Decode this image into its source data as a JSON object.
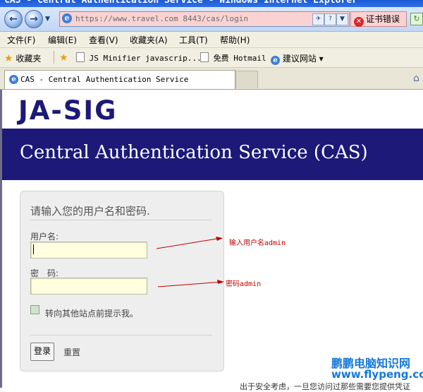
{
  "window": {
    "title": "CAS  -  Central Authentication Service  -  Windows Internet Explorer"
  },
  "address_bar": {
    "url": "https://www.travel.com 8443/cas/login",
    "cert_error": "证书错误"
  },
  "menu": {
    "items": [
      "文件(F)",
      "编辑(E)",
      "查看(V)",
      "收藏夹(A)",
      "工具(T)",
      "帮助(H)"
    ]
  },
  "favorites_bar": {
    "favorites_label": "收藏夹",
    "items": [
      "JS Minifier javascrip...",
      "免费 Hotmail",
      "建议网站"
    ]
  },
  "tab": {
    "label": "CAS  -  Central Authentication Service"
  },
  "page": {
    "logo_text": "JA-SIG",
    "banner_title": "Central Authentication Service (CAS)",
    "form": {
      "heading": "请输入您的用户名和密码.",
      "username_label": "用户名:",
      "username_value": "",
      "password_label": "密　码:",
      "password_value": "",
      "warn_label": "转向其他站点前提示我。",
      "submit_label": "登录",
      "reset_label": "重置"
    },
    "footer_text": "出于安全考虑，一旦您访问过那些需要您提供凭证"
  },
  "annotations": {
    "username_note": "输入用户名admin",
    "password_note": "密码admin"
  },
  "watermark": {
    "line1": "鹏鹏电脑知识网",
    "line2": "www.flypeng.com"
  },
  "colors": {
    "banner": "#1c1978",
    "annotation": "#c20000",
    "watermark": "#1378d8",
    "cert_error_bg": "#fbd2d2"
  }
}
